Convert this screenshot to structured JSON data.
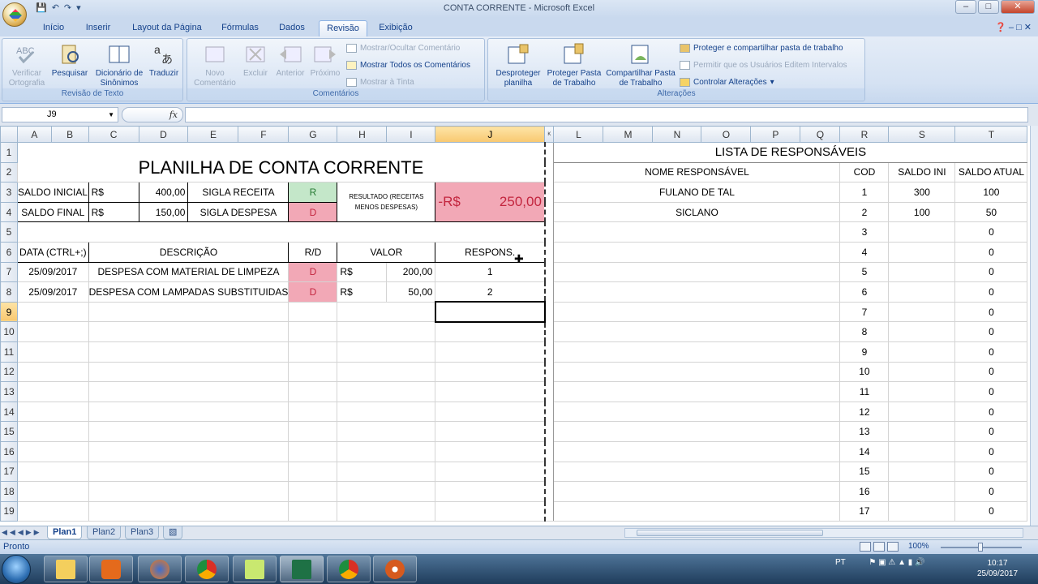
{
  "window": {
    "title": "CONTA CORRENTE - Microsoft Excel"
  },
  "tabs": [
    "Início",
    "Inserir",
    "Layout da Página",
    "Fórmulas",
    "Dados",
    "Revisão",
    "Exibição"
  ],
  "active_tab": "Revisão",
  "ribbon": {
    "proofing": {
      "label": "Revisão de Texto",
      "spelling": "Verificar Ortografia",
      "research": "Pesquisar",
      "thesaurus": "Dicionário de Sinônimos",
      "translate": "Traduzir"
    },
    "comments": {
      "label": "Comentários",
      "new": "Novo Comentário",
      "delete": "Excluir",
      "previous": "Anterior",
      "next": "Próximo",
      "show_hide": "Mostrar/Ocultar Comentário",
      "show_all": "Mostrar Todos os Comentários",
      "show_ink": "Mostrar à Tinta"
    },
    "changes": {
      "label": "Alterações",
      "unprotect_sheet": "Desproteger planilha",
      "protect_workbook": "Proteger Pasta de Trabalho",
      "share_workbook": "Compartilhar Pasta de Trabalho",
      "protect_share": "Proteger e compartilhar pasta de trabalho",
      "allow_edit": "Permitir que os Usuários Editem Intervalos",
      "track_changes": "Controlar Alterações"
    }
  },
  "formula_bar": {
    "name_box": "J9",
    "fx": "fx",
    "content": ""
  },
  "columns": [
    "A",
    "B",
    "C",
    "D",
    "E",
    "F",
    "G",
    "H",
    "I",
    "J",
    "K",
    "L",
    "M",
    "N",
    "O",
    "P",
    "Q",
    "R",
    "S",
    "T"
  ],
  "rows": [
    "1",
    "2",
    "3",
    "4",
    "5",
    "6",
    "7",
    "8",
    "9",
    "10",
    "11",
    "12",
    "13",
    "14",
    "15",
    "16",
    "17",
    "18",
    "19"
  ],
  "sheet": {
    "title": "PLANILHA DE CONTA CORRENTE",
    "saldo_inicial_label": "SALDO INICIAL",
    "saldo_inicial_cur": "R$",
    "saldo_inicial_val": "400,00",
    "saldo_final_label": "SALDO FINAL",
    "saldo_final_cur": "R$",
    "saldo_final_val": "150,00",
    "sigla_receita_label": "SIGLA RECEITA",
    "sigla_receita": "R",
    "sigla_despesa_label": "SIGLA DESPESA",
    "sigla_despesa": "D",
    "resultado_label": "RESULTADO (RECEITAS MENOS DESPESAS)",
    "resultado_cur": "-R$",
    "resultado_val": "250,00",
    "headers": {
      "data": "DATA (CTRL+;)",
      "descricao": "DESCRIÇÃO",
      "rd": "R/D",
      "valor": "VALOR",
      "respons": "RESPONS."
    },
    "entries": [
      {
        "data": "25/09/2017",
        "descricao": "DESPESA COM MATERIAL DE LIMPEZA",
        "rd": "D",
        "cur": "R$",
        "valor": "200,00",
        "respons": "1"
      },
      {
        "data": "25/09/2017",
        "descricao": "DESPESA COM LAMPADAS SUBSTITUIDAS",
        "rd": "D",
        "cur": "R$",
        "valor": "50,00",
        "respons": "2"
      }
    ],
    "resp_title": "LISTA DE RESPONSÁVEIS",
    "resp_headers": {
      "nome": "NOME RESPONSÁVEL",
      "cod": "COD",
      "saldo_ini": "SALDO INI",
      "saldo_atual": "SALDO ATUAL"
    },
    "resp_rows": [
      {
        "nome": "FULANO DE TAL",
        "cod": "1",
        "ini": "300",
        "atual": "100"
      },
      {
        "nome": "SICLANO",
        "cod": "2",
        "ini": "100",
        "atual": "50"
      },
      {
        "nome": "",
        "cod": "3",
        "ini": "",
        "atual": "0"
      },
      {
        "nome": "",
        "cod": "4",
        "ini": "",
        "atual": "0"
      },
      {
        "nome": "",
        "cod": "5",
        "ini": "",
        "atual": "0"
      },
      {
        "nome": "",
        "cod": "6",
        "ini": "",
        "atual": "0"
      },
      {
        "nome": "",
        "cod": "7",
        "ini": "",
        "atual": "0"
      },
      {
        "nome": "",
        "cod": "8",
        "ini": "",
        "atual": "0"
      },
      {
        "nome": "",
        "cod": "9",
        "ini": "",
        "atual": "0"
      },
      {
        "nome": "",
        "cod": "10",
        "ini": "",
        "atual": "0"
      },
      {
        "nome": "",
        "cod": "11",
        "ini": "",
        "atual": "0"
      },
      {
        "nome": "",
        "cod": "12",
        "ini": "",
        "atual": "0"
      },
      {
        "nome": "",
        "cod": "13",
        "ini": "",
        "atual": "0"
      },
      {
        "nome": "",
        "cod": "14",
        "ini": "",
        "atual": "0"
      },
      {
        "nome": "",
        "cod": "15",
        "ini": "",
        "atual": "0"
      },
      {
        "nome": "",
        "cod": "16",
        "ini": "",
        "atual": "0"
      },
      {
        "nome": "",
        "cod": "17",
        "ini": "",
        "atual": "0"
      }
    ]
  },
  "sheet_tabs": [
    "Plan1",
    "Plan2",
    "Plan3"
  ],
  "status": {
    "ready": "Pronto",
    "zoom": "100%"
  },
  "taskbar": {
    "lang": "PT",
    "time": "10:17",
    "date": "25/09/2017"
  },
  "colors": {
    "pink": "#f2a8b6",
    "green": "#c4e7c9",
    "accent": "#15428b"
  }
}
